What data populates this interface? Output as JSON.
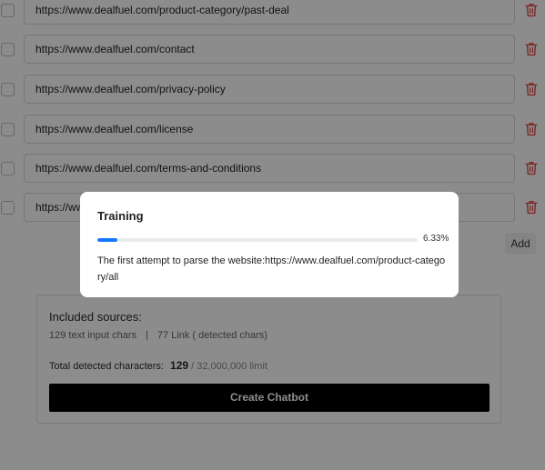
{
  "url_list": [
    {
      "url": "https://www.dealfuel.com/product-category/past-deal",
      "checked": false
    },
    {
      "url": "https://www.dealfuel.com/contact",
      "checked": false
    },
    {
      "url": "https://www.dealfuel.com/privacy-policy",
      "checked": false
    },
    {
      "url": "https://www.dealfuel.com/license",
      "checked": false
    },
    {
      "url": "https://www.dealfuel.com/terms-and-conditions",
      "checked": false
    },
    {
      "url": "https://www.dealfuel.com/",
      "checked": false
    }
  ],
  "add_button_label": "Add",
  "sources": {
    "title": "Included sources:",
    "text_chars": "129 text input chars",
    "separator": "|",
    "link_chars": "77 Link ( detected chars)",
    "total_label": "Total detected characters:",
    "total_value": "129",
    "limit": "/ 32,000,000 limit",
    "create_button_label": "Create Chatbot"
  },
  "modal": {
    "title": "Training",
    "progress_percent": 6.33,
    "progress_text": "6.33%",
    "message": "The first attempt to parse the website:https://www.dealfuel.com/product-category/all"
  },
  "colors": {
    "accent": "#1677ff",
    "danger": "#e0403b",
    "primary_button": "#000000",
    "overlay": "rgba(0,0,0,0.45)"
  },
  "icons": {
    "row_delete": "trash-icon"
  }
}
